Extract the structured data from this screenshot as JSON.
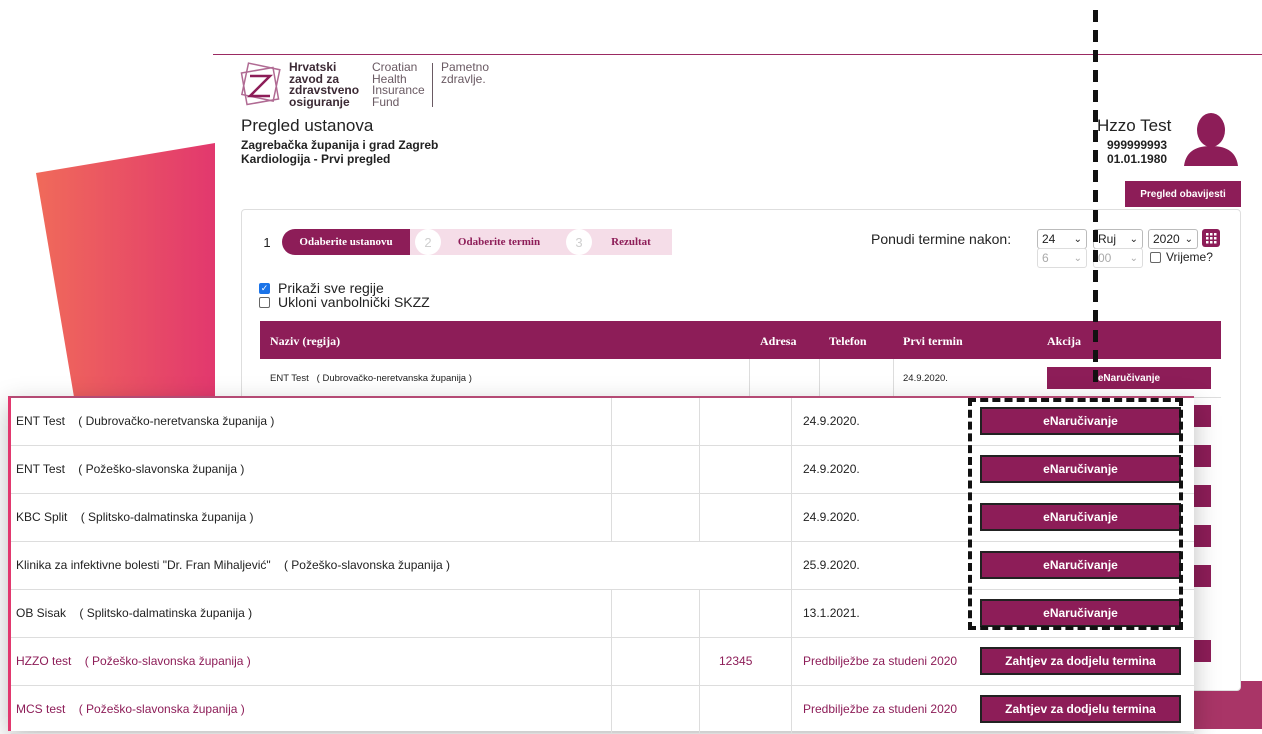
{
  "logo": {
    "hr_lines": [
      "Hrvatski",
      "zavod za",
      "zdravstveno",
      "osiguranje"
    ],
    "en_lines": [
      "Croatian",
      "Health",
      "Insurance",
      "Fund"
    ],
    "tag_lines": [
      "Pametno",
      "zdravlje."
    ]
  },
  "header": {
    "title": "Pregled ustanova",
    "region": "Zagrebačka županija i grad Zagreb",
    "service": "Kardiologija - Prvi pregled"
  },
  "user": {
    "name": "Hzzo Test",
    "id": "999999993",
    "dob": "01.01.1980",
    "notifications_label": "Pregled obavijesti"
  },
  "steps": [
    {
      "num": "1",
      "label": "Odaberite ustanovu"
    },
    {
      "num": "2",
      "label": "Odaberite termin"
    },
    {
      "num": "3",
      "label": "Rezultat"
    }
  ],
  "date_filter": {
    "label": "Ponudi termine nakon:",
    "day": "24",
    "month": "Ruj",
    "year": "2020",
    "hour": "6",
    "minute": "00",
    "time_label": "Vrijeme?"
  },
  "options": {
    "show_all_regions": "Prikaži sve regije",
    "remove_outpatient": "Ukloni vanbolnički SKZZ"
  },
  "table": {
    "columns": [
      "Naziv (regija)",
      "Adresa",
      "Telefon",
      "Prvi termin",
      "Akcija"
    ],
    "first_row": {
      "name": "ENT Test",
      "region": "( Dubrovačko-neretvanska županija )",
      "date": "24.9.2020.",
      "action": "eNaručivanje"
    }
  },
  "zoom_rows": [
    {
      "name": "ENT Test",
      "region": "( Dubrovačko-neretvanska županija )",
      "phone": "",
      "date": "24.9.2020.",
      "action": "eNaručivanje"
    },
    {
      "name": "ENT Test",
      "region": "( Požeško-slavonska županija )",
      "phone": "",
      "date": "24.9.2020.",
      "action": "eNaručivanje"
    },
    {
      "name": "KBC Split",
      "region": "( Splitsko-dalmatinska županija )",
      "phone": "",
      "date": "24.9.2020.",
      "action": "eNaručivanje"
    },
    {
      "name": "Klinika za infektivne bolesti \"Dr. Fran Mihaljević\"",
      "region": "( Požeško-slavonska županija )",
      "phone": "",
      "date": "25.9.2020.",
      "action": "eNaručivanje"
    },
    {
      "name": "OB Sisak",
      "region": "( Splitsko-dalmatinska županija )",
      "phone": "",
      "date": "13.1.2021.",
      "action": "eNaručivanje"
    },
    {
      "name": "HZZO test",
      "region": "( Požeško-slavonska županija )",
      "phone": "12345",
      "date": "Predbilježbe za studeni 2020",
      "action": "Zahtjev za dodjelu termina"
    },
    {
      "name": "MCS test",
      "region": "( Požeško-slavonska županija )",
      "phone": "",
      "date": "Predbilježbe za studeni 2020",
      "action": "Zahtjev za dodjelu termina"
    }
  ],
  "colors": {
    "brand": "#8d1d58",
    "brand_light": "#f5dde8",
    "accent_red": "#e95a5c"
  }
}
